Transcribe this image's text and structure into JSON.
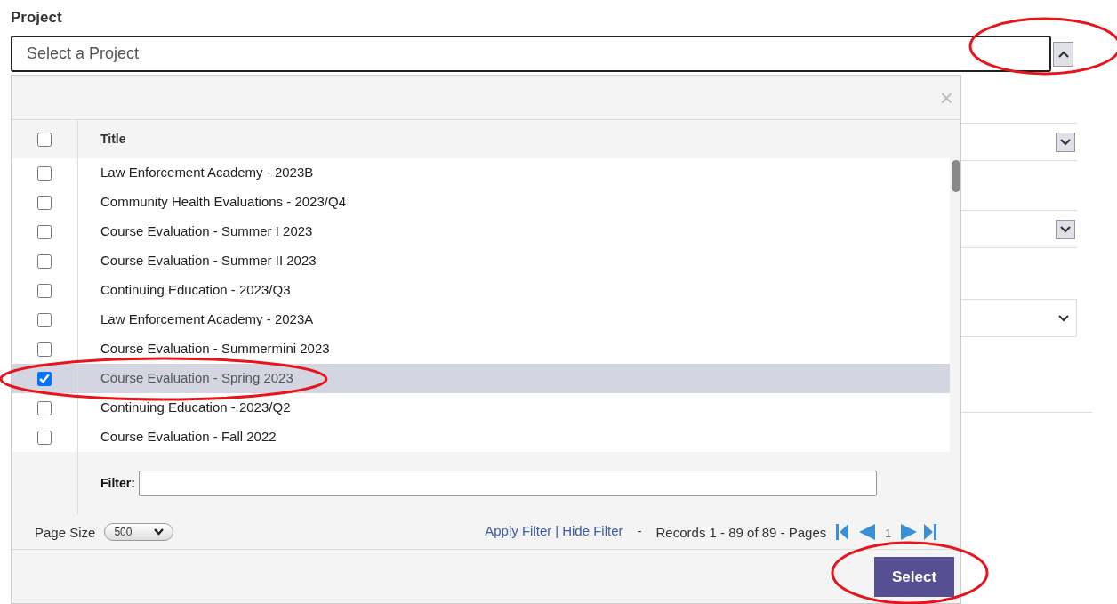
{
  "field": {
    "label": "Project",
    "placeholder": "Select a Project",
    "expanded": true
  },
  "popup": {
    "close": "×",
    "column": "Title",
    "header_checked": false,
    "rows": [
      {
        "title": "Law Enforcement Academy - 2023B",
        "checked": false,
        "selected": false
      },
      {
        "title": "Community Health Evaluations - 2023/Q4",
        "checked": false,
        "selected": false
      },
      {
        "title": "Course Evaluation - Summer I 2023",
        "checked": false,
        "selected": false
      },
      {
        "title": "Course Evaluation - Summer II 2023",
        "checked": false,
        "selected": false
      },
      {
        "title": "Continuing Education - 2023/Q3",
        "checked": false,
        "selected": false
      },
      {
        "title": "Law Enforcement Academy - 2023A",
        "checked": false,
        "selected": false
      },
      {
        "title": "Course Evaluation - Summermini 2023",
        "checked": false,
        "selected": false
      },
      {
        "title": "Course Evaluation - Spring 2023",
        "checked": true,
        "selected": true
      },
      {
        "title": "Continuing Education - 2023/Q2",
        "checked": false,
        "selected": false
      },
      {
        "title": "Course Evaluation - Fall 2022",
        "checked": false,
        "selected": false
      }
    ],
    "filter_label": "Filter:",
    "page_size_label": "Page Size",
    "page_size": "500",
    "apply_filter": "Apply Filter",
    "separator": "|",
    "hide_filter": "Hide Filter",
    "dash": "-",
    "records": "Records 1 - 89 of 89 - Pages",
    "page": "1",
    "select_button": "Select"
  }
}
